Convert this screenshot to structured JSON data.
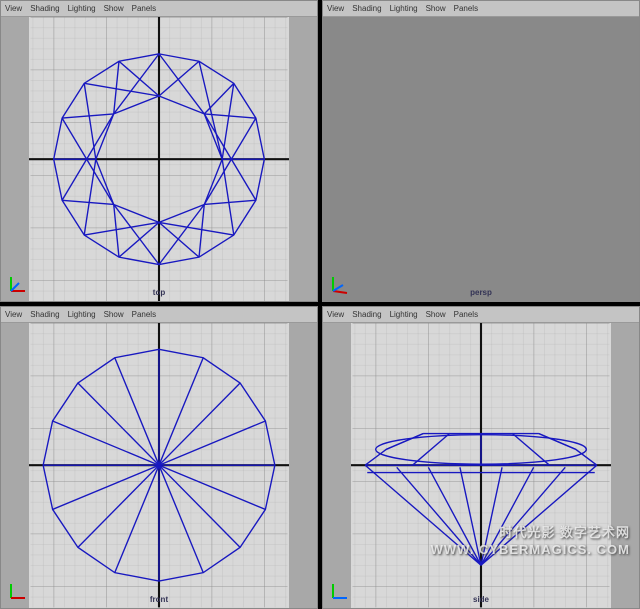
{
  "menus": {
    "view": "View",
    "shading": "Shading",
    "lighting": "Lighting",
    "show": "Show",
    "panels": "Panels"
  },
  "viewports": {
    "top": {
      "label": "top"
    },
    "persp": {
      "label": "persp"
    },
    "front": {
      "label": "front"
    },
    "side": {
      "label": "side"
    }
  },
  "colors": {
    "wireframe": "#1818c0",
    "grid_major": "#666666",
    "grid_minor": "#b0b0b0",
    "axis_dark": "#101010",
    "persp_bg": "#898989"
  },
  "gizmo": {
    "x": "x",
    "y": "y",
    "z": "z"
  },
  "watermark": {
    "line1": "时代光影 数字艺术网",
    "line2": "WWW. CYBERMAGICS. COM"
  }
}
